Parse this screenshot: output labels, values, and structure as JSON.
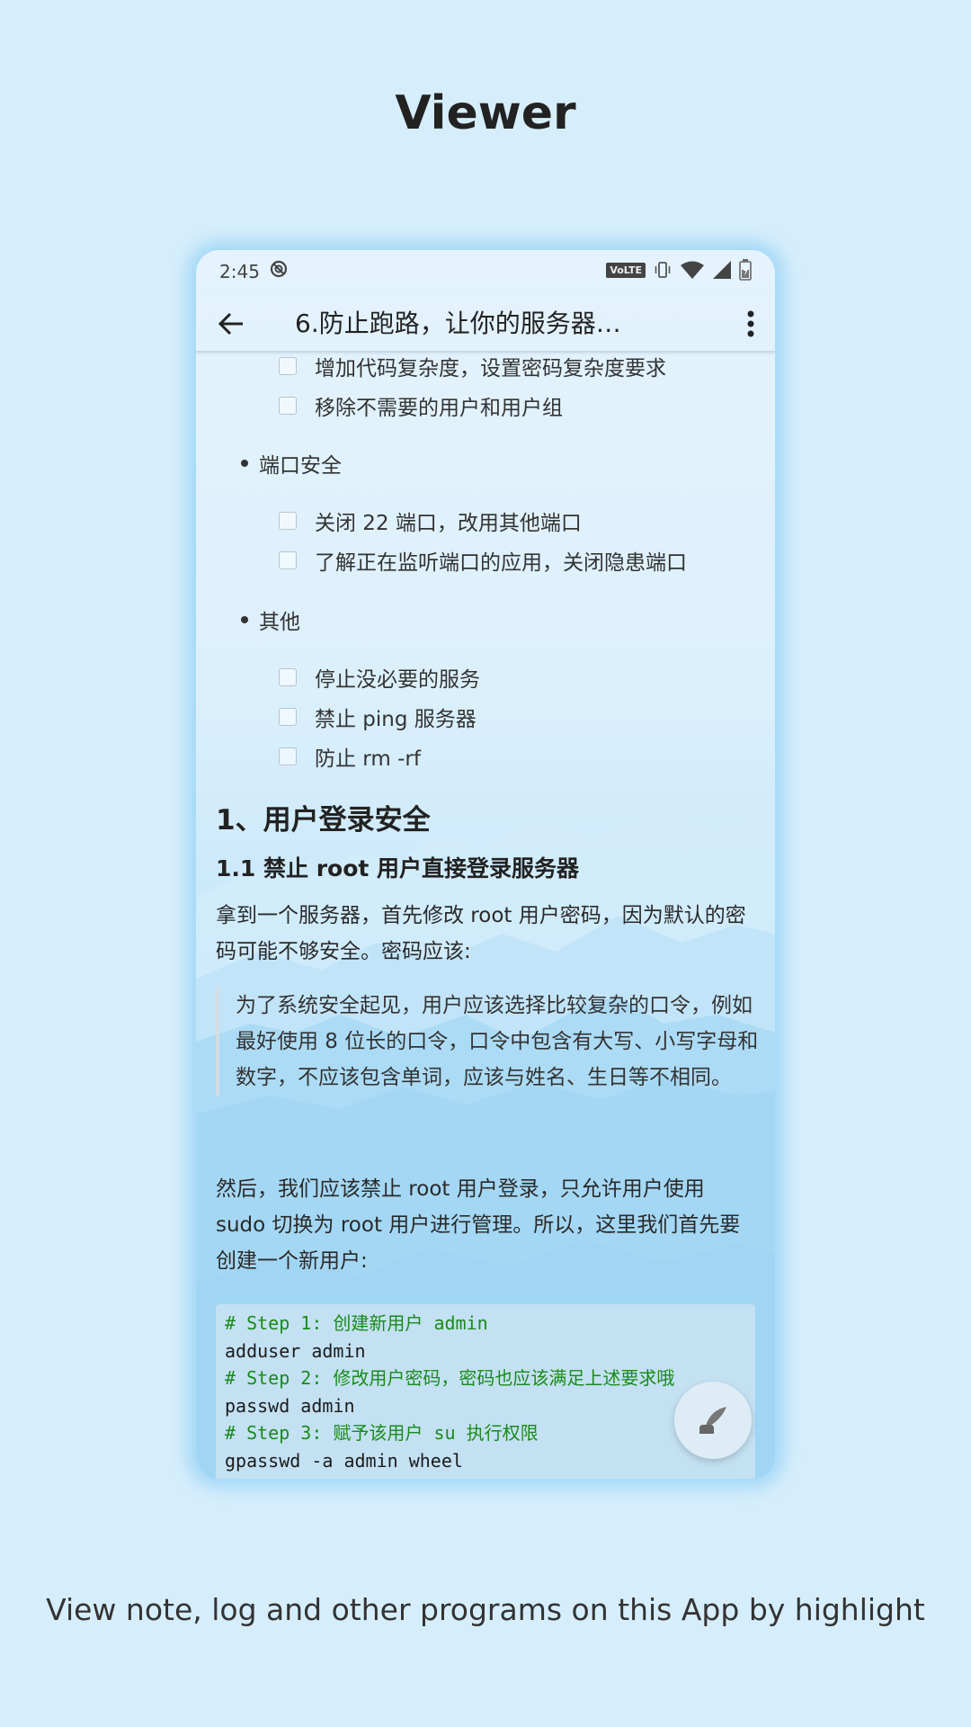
{
  "promo": {
    "heading": "Viewer",
    "caption": "View note, log and other programs on this App by highlight"
  },
  "statusbar": {
    "time": "2:45",
    "volte": "VoLTE"
  },
  "appbar": {
    "title": "6.防止跑路，让你的服务器…"
  },
  "content": {
    "items_top": [
      "增加代码复杂度，设置密码复杂度要求",
      "移除不需要的用户和用户组"
    ],
    "bullet_port": "端口安全",
    "items_port": [
      "关闭 22 端口，改用其他端口",
      "了解正在监听端口的应用，关闭隐患端口"
    ],
    "bullet_other": "其他",
    "items_other": [
      "停止没必要的服务",
      "禁止 ping 服务器",
      "防止 rm -rf"
    ],
    "h1": "1、用户登录安全",
    "h2": "1.1 禁止 root 用户直接登录服务器",
    "para1": "拿到一个服务器，首先修改 root 用户密码，因为默认的密码可能不够安全。密码应该:",
    "quote": "为了系统安全起见，用户应该选择比较复杂的口令，例如最好使用 8 位长的口令，口令中包含有大写、小写字母和数字，不应该包含单词，应该与姓名、生日等不相同。",
    "para2": "然后，我们应该禁止 root 用户登录，只允许用户使用 sudo 切换为 root 用户进行管理。所以，这里我们首先要创建一个新用户:",
    "code": [
      {
        "type": "comment",
        "text": "# Step 1: 创建新用户 admin"
      },
      {
        "type": "cmd",
        "text": "adduser admin"
      },
      {
        "type": "comment",
        "text": "# Step 2: 修改用户密码，密码也应该满足上述要求哦"
      },
      {
        "type": "cmd",
        "text": "passwd admin"
      },
      {
        "type": "comment",
        "text": "# Step 3: 赋予该用户 su 执行权限"
      },
      {
        "type": "cmd",
        "text": "gpasswd -a admin wheel"
      }
    ]
  },
  "icons": {
    "back": "arrow-left-icon",
    "more": "more-vertical-icon",
    "fab": "quill-pen-icon",
    "dnd": "do-not-disturb-icon",
    "vibrate": "vibrate-icon",
    "wifi": "wifi-icon",
    "signal": "signal-icon",
    "battery": "battery-icon"
  },
  "colors": {
    "background": "#d6eefc",
    "code_comment": "#1a8a1a"
  }
}
